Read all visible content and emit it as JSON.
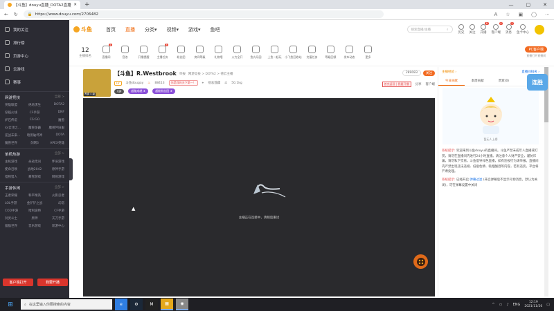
{
  "browser": {
    "tab_title": "【斗鱼】douyu直播_DOTA2直播_斗鱼直播",
    "url": "https://www.douyu.com/2706482",
    "controls": {
      "minimize": "—",
      "maximize": "▢",
      "close": "✕"
    }
  },
  "sidebar": {
    "top_items": [
      {
        "label": "我的关注",
        "icon": "heart-icon"
      },
      {
        "label": "排行榜",
        "icon": "rank-icon"
      },
      {
        "label": "页游中心",
        "icon": "gamepad-icon"
      },
      {
        "label": "云游戏",
        "icon": "cloud-icon"
      },
      {
        "label": "赛事",
        "icon": "trophy-icon"
      }
    ],
    "sections": [
      {
        "title": "网游竞技",
        "more": "全部 >",
        "items": [
          "英雄联盟",
          "绝地求生",
          "DOTA2",
          "穿越火线",
          "CF手游",
          "DNF",
          "炉石传说",
          "CS:GO",
          "魔兽",
          "lol云顶之...",
          "魔兽争霸",
          "魔兽怀旧服",
          "逆战未来...",
          "暗黑破坏神",
          "DOTA",
          "魔兽世界",
          "剑网3",
          "APEX英雄"
        ]
      },
      {
        "title": "单机热游",
        "more": "全部 >",
        "items": [
          "主机游戏",
          "永劫无间",
          "怀旧游戏",
          "使命召唤",
          "战地2042",
          "原神手游",
          "怪物猎人",
          "暴雪游戏",
          "网易游戏"
        ]
      },
      {
        "title": "手游休闲",
        "more": "全部 >",
        "items": [
          "王者荣耀",
          "和平精英",
          "火影忍者",
          "LOL手游",
          "金铲铲之战",
          "幻塔",
          "COD手游",
          "哈利波特",
          "CF手游",
          "剑灵斗士",
          "原神",
          "天刀手游",
          "猫猫世界",
          "音乐游戏",
          "新游中心"
        ]
      }
    ],
    "bottom_buttons": [
      "客户端打开",
      "我要开播"
    ]
  },
  "header": {
    "logo_text": "斗鱼",
    "nav": [
      "首页",
      "直播",
      "分类▾",
      "视频▾",
      "游戏▾",
      "鱼吧"
    ],
    "active_nav": "直播",
    "search_placeholder": "搜索直播/主播",
    "icons": [
      {
        "label": "历史",
        "badge": ""
      },
      {
        "label": "关注",
        "badge": ""
      },
      {
        "label": "开播",
        "badge": "6"
      },
      {
        "label": "客户端",
        "badge": "4"
      },
      {
        "label": "消息",
        "badge": "1"
      },
      {
        "label": "鱼卡中心",
        "badge": ""
      }
    ]
  },
  "toolbar": {
    "rank_value": "12",
    "rank_label": "主播排名",
    "items": [
      {
        "label": "直播间",
        "badge": "1"
      },
      {
        "label": "音浪",
        "badge": ""
      },
      {
        "label": "开播提醒",
        "badge": ""
      },
      {
        "label": "主播任务",
        "badge": "3"
      },
      {
        "label": "粉丝团",
        "badge": ""
      },
      {
        "label": "房间等级",
        "badge": ""
      },
      {
        "label": "礼物墙",
        "badge": ""
      },
      {
        "label": "火力全开",
        "badge": ""
      },
      {
        "label": "鱼丸乐园",
        "badge": ""
      },
      {
        "label": "上鱼一起玩",
        "badge": ""
      },
      {
        "label": "小飞鱼回收站",
        "badge": ""
      },
      {
        "label": "充值任务",
        "badge": ""
      },
      {
        "label": "等级回馈",
        "badge": ""
      },
      {
        "label": "发布动态",
        "badge": ""
      },
      {
        "label": "更多",
        "badge": ""
      }
    ],
    "pc_button": "PC客户端",
    "pc_sub": "直播打开直播间"
  },
  "room": {
    "title": "【斗鱼】R.Westbrook",
    "category_prefix": "举报",
    "category_path": "网游竞技 > DOTA2 > 德云主播",
    "level_tag": "LV",
    "anchor_name": "斗鱼dougay",
    "hot_value": "88413",
    "tag_red": "你是我的天下第一！",
    "location": "他总莲藕",
    "weight": "50.1kg",
    "avatar_level": "青铜 4 级",
    "pills": [
      {
        "label": "VIP",
        "color": "#555555"
      },
      {
        "label": "超能成就 ★",
        "color": "#8a4fd8"
      },
      {
        "label": "超能粉丝团 ★",
        "color": "#8a4fd8"
      }
    ],
    "follow_count": "289083",
    "follow_label": "关注",
    "actions": [
      "首充返现 | 我要开播",
      "分享",
      "客户端"
    ]
  },
  "player": {
    "message": "主播正在连接中，请稍后重试"
  },
  "chat": {
    "head_left": "主播经验 ›",
    "head_right": "直播间排名 ›",
    "tabs": [
      "今日贡献",
      "本周贡献",
      "贵宾(0)",
      "钻粉"
    ],
    "active_tab": "今日贡献",
    "illustration_caption": "暂无人上榜",
    "messages": [
      {
        "prefix": "系统提示:",
        "text": "欢迎来到斗鱼douyu的直播间。斗鱼严禁未成年人直播或打赏，请勿在直播间内进行24小时直播。请注意个人财产安全，谨防诈骗，请勿私下交易，斗鱼倡导绿色直播，如有违规行为请举报。直播间内严禁出现违法违规、低俗色情、吸烟酗酒等内容，若有违反，平台将严肃处理。"
      },
      {
        "prefix": "系统提示:",
        "text": "已经开启",
        "link": "弹幕过滤",
        "text2": "(开启弹幕后不显示礼物消息，默认为关闭)，可在弹幕设置中关闭"
      }
    ]
  },
  "mascot_text": "连胜",
  "taskbar": {
    "search_placeholder": "在这里输入你要搜索的内容",
    "apps": [
      "e",
      "⚙",
      "M",
      "▦",
      "◉"
    ],
    "lang": "ENG",
    "time": "12:19",
    "date": "2021/11/26"
  }
}
